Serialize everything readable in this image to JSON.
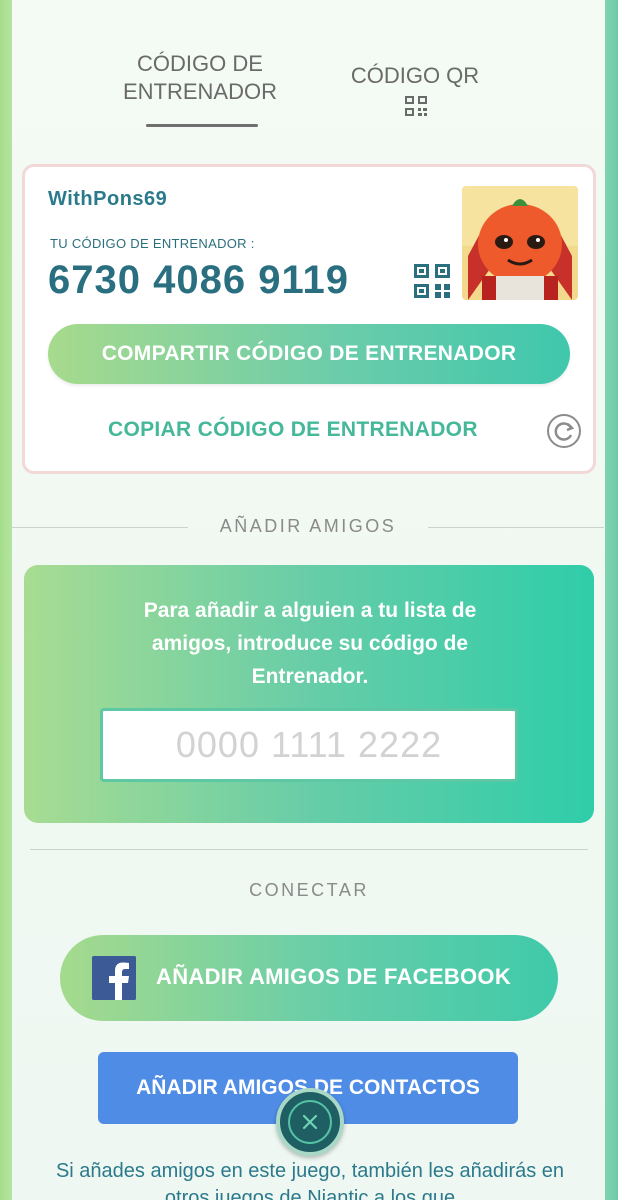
{
  "tabs": {
    "trainer_code_label": "CÓDIGO DE ENTRENADOR",
    "qr_code_label": "CÓDIGO QR"
  },
  "trainer_card": {
    "username": "WithPons69",
    "code_label": "TU CÓDIGO DE ENTRENADOR :",
    "code_value": "6730 4086 9119",
    "share_button": "COMPARTIR CÓDIGO DE ENTRENADOR",
    "copy_link": "COPIAR CÓDIGO DE ENTRENADOR"
  },
  "add_friends": {
    "section_title": "AÑADIR AMIGOS",
    "instruction": "Para añadir a alguien a tu lista de amigos, introduce su código de Entrenador.",
    "input_placeholder": "0000 1111 2222",
    "input_value": ""
  },
  "connect": {
    "section_title": "CONECTAR",
    "facebook_button": "AÑADIR AMIGOS DE FACEBOOK",
    "contacts_button": "AÑADIR AMIGOS DE CONTACTOS",
    "footer_text": "Si añades amigos en este juego, también les añadirás en otros juegos de Niantic a los que"
  },
  "icons": {
    "qr": "qr-code-icon",
    "copy": "copy-icon",
    "facebook": "facebook-icon",
    "close": "close-icon"
  },
  "colors": {
    "accent_teal": "#2a6f80",
    "green_gradient_start": "#a7da8d",
    "green_gradient_end": "#3fc7ac",
    "contacts_blue": "#4e8ce6",
    "facebook_blue": "#3b5a96"
  }
}
